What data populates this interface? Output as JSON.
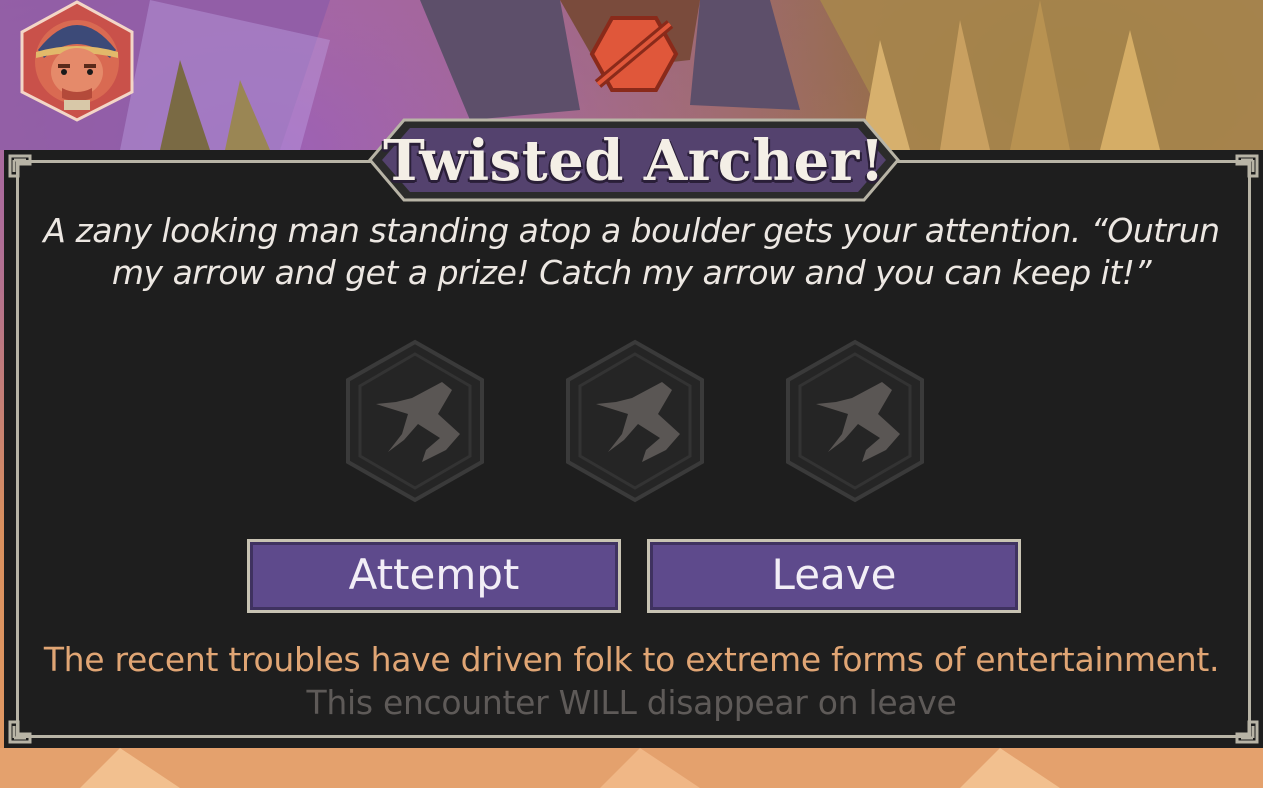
{
  "encounter": {
    "title": "Twisted Archer!",
    "description": "A zany looking man standing atop a boulder gets your attention. “Outrun my arrow and get a prize! Catch my arrow and you can keep it!”",
    "attempt_icons": [
      "running-figure-icon",
      "running-figure-icon",
      "running-figure-icon"
    ],
    "buttons": {
      "attempt_label": "Attempt",
      "leave_label": "Leave"
    },
    "flavor_text": "The recent troubles have driven folk to extreme forms of entertainment.",
    "warning_text": "This encounter WILL disappear on leave"
  },
  "colors": {
    "panel_bg": "#1e1e1e",
    "button_bg": "#5e4a8c",
    "title_banner_bg": "#54426e",
    "flavor_text": "#e0a574",
    "warning_text": "#5e5a58",
    "status_icon": "#e0573a"
  }
}
